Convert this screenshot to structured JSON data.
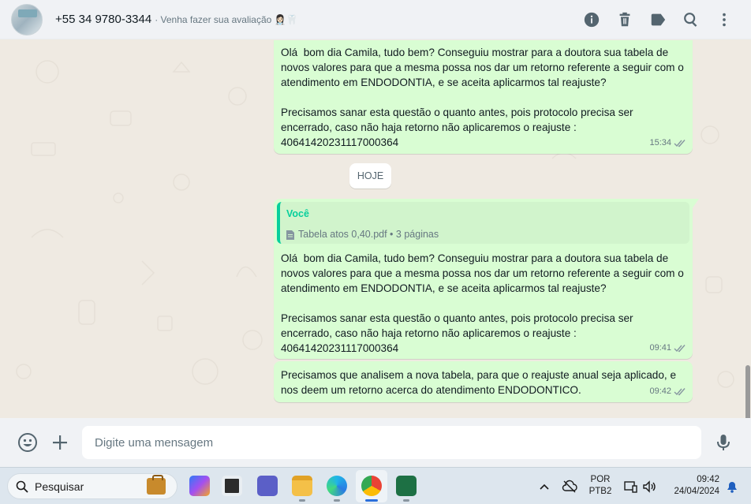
{
  "header": {
    "contact_name": "+55 34 9780-3344",
    "contact_subtitle": "· Venha fazer sua avaliação 👩🏻‍⚕️🦷",
    "icons": [
      "info-icon",
      "trash-icon",
      "label-icon",
      "search-icon",
      "menu-dots-icon"
    ]
  },
  "chat": {
    "messages": [
      {
        "text": "Olá  bom dia Camila, tudo bem? Conseguiu mostrar para a doutora sua tabela de novos valores para que a mesma possa nos dar um retorno referente a seguir com o atendimento em ENDODONTIA, e se aceita aplicarmos tal reajuste?\n\nPrecisamos sanar esta questão o quanto antes, pois protocolo precisa ser encerrado, caso não haja retorno não aplicaremos o reajuste : 40641420231117000364",
        "time": "15:34"
      },
      {
        "quote_author": "Você",
        "quote_doc": "Tabela atos 0,40.pdf • 3 páginas",
        "text": "Olá  bom dia Camila, tudo bem? Conseguiu mostrar para a doutora sua tabela de novos valores para que a mesma possa nos dar um retorno referente a seguir com o atendimento em ENDODONTIA, e se aceita aplicarmos tal reajuste?\n\nPrecisamos sanar esta questão o quanto antes, pois protocolo precisa ser encerrado, caso não haja retorno não aplicaremos o reajuste : 40641420231117000364",
        "time": "09:41"
      },
      {
        "text": "Precisamos que analisem a nova tabela, para que o reajuste anual seja aplicado, e nos deem um retorno acerca do atendimento ENDODONTICO.",
        "time": "09:42"
      }
    ],
    "day_divider": "HOJE"
  },
  "composer": {
    "placeholder": "Digite uma mensagem"
  },
  "taskbar": {
    "search_label": "Pesquisar",
    "lang_top": "POR",
    "lang_bottom": "PTB2",
    "time": "09:42",
    "date": "24/04/2024"
  },
  "colors": {
    "outgoing_bubble": "#d9fdd3",
    "quote_accent": "#06cf9c",
    "chat_background": "#efeae2",
    "read_ticks": "#8696a0"
  }
}
